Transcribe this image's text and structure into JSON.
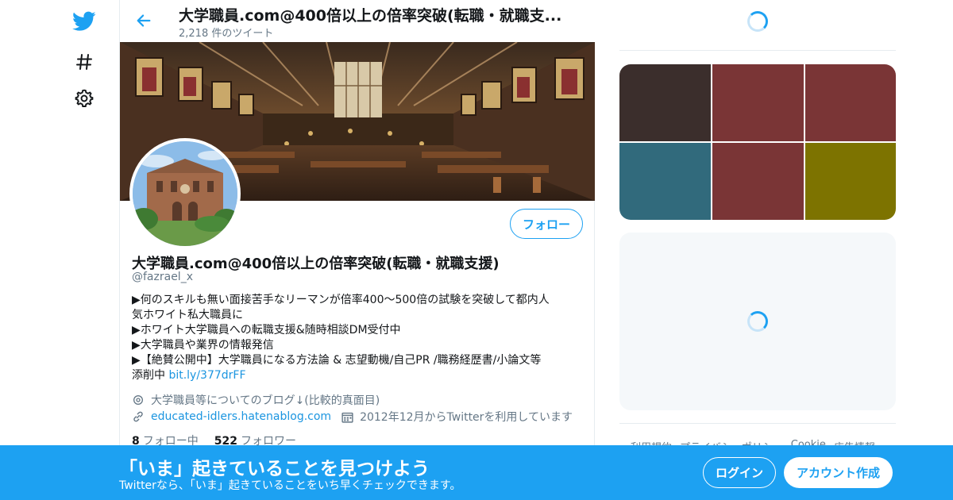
{
  "colors": {
    "accent": "#1da1f2",
    "link": "#1b95e0",
    "secondary_text": "#657786",
    "media_cells": [
      "#3b2e2c",
      "#7a3536",
      "#7a3536",
      "#316a7c",
      "#7a3536",
      "#7d7300"
    ]
  },
  "nav": {
    "icons": [
      "twitter-bird-icon",
      "hashtag-icon",
      "settings-gear-icon"
    ]
  },
  "header": {
    "title": "大学職員.com@400倍以上の倍率突破(転職・就職支...",
    "tweet_count": "2,218 件のツイート"
  },
  "profile": {
    "follow_label": "フォロー",
    "name": "大学職員.com@400倍以上の倍率突破(転職・就職支援)",
    "handle": "@fazrael_x",
    "bio_lines": [
      "▶何のスキルも無い面接苦手なリーマンが倍率400～500倍の試験を突破して都内人",
      "気ホワイト私大職員に",
      "▶ホワイト大学職員への転職支援&随時相談DM受付中",
      "▶大学職員や業界の情報発信",
      "▶【絶賛公開中】大学職員になる方法論 & 志望動機/自己PR /職務経歴書/小論文等"
    ],
    "bio_last_prefix": "添削中 ",
    "bio_link": "bit.ly/377drFF",
    "location": "大学職員等についてのブログ↓(比較的真面目)",
    "website": "educated-idlers.hatenablog.com",
    "joined": "2012年12月からTwitterを利用しています",
    "following_count": "8",
    "following_label": "フォロー中",
    "followers_count": "522",
    "followers_label": "フォロワー"
  },
  "footer": {
    "links": [
      "利用規約",
      "プライバシーポリシー",
      "Cookie",
      "広告情報"
    ]
  },
  "bottom_bar": {
    "title": "「いま」起きていることを見つけよう",
    "subtitle": "Twitterなら、「いま」起きていることをいち早くチェックできます。",
    "login_label": "ログイン",
    "signup_label": "アカウント作成"
  }
}
